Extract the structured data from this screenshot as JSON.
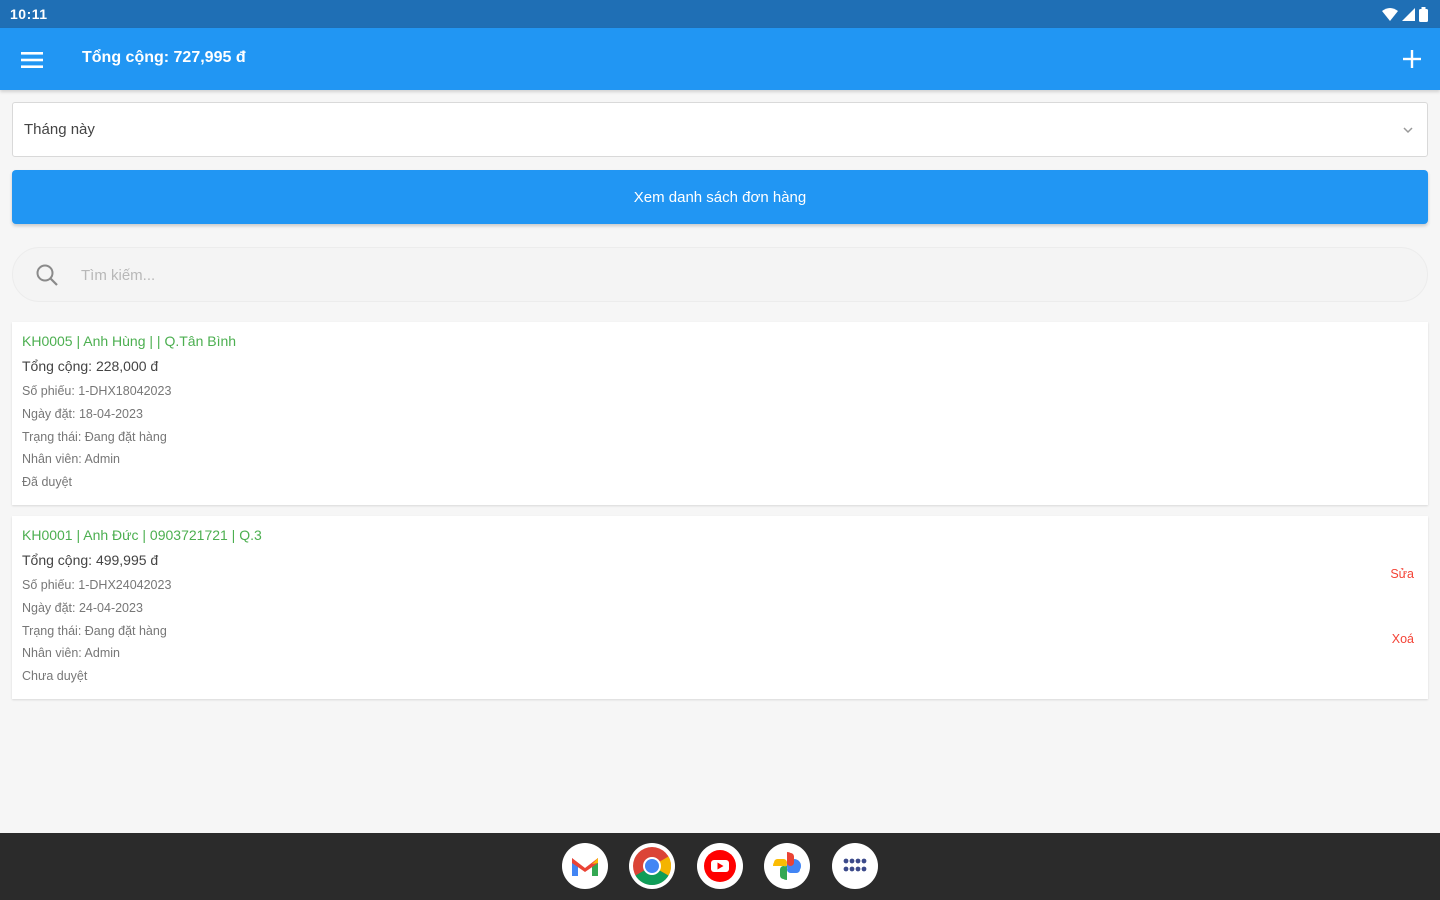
{
  "status_bar": {
    "time": "10:11",
    "icons": [
      "wifi-icon",
      "signal-icon",
      "battery-icon"
    ]
  },
  "app_bar": {
    "title": "Tổng cộng: 727,995 đ",
    "icons": [
      "menu-icon",
      "plus-icon"
    ]
  },
  "period_select": {
    "selected": "Tháng này"
  },
  "view_orders_button": {
    "label": "Xem danh sách đơn hàng"
  },
  "search": {
    "placeholder": "Tìm kiếm...",
    "value": ""
  },
  "orders": [
    {
      "header": "KH0005 | Anh Hùng |  | Q.Tân Bình",
      "total": "Tổng cộng: 228,000 đ",
      "ticket": "Số phiếu: 1-DHX18042023",
      "date": "Ngày đặt: 18-04-2023",
      "status": "Trạng thái: Đang đặt hàng",
      "employee": "Nhân viên: Admin",
      "approval": "Đã duyệt"
    },
    {
      "header": "KH0001 | Anh Đức | 0903721721 | Q.3",
      "total": "Tổng cộng: 499,995 đ",
      "ticket": "Số phiếu: 1-DHX24042023",
      "date": "Ngày đặt: 24-04-2023",
      "status": "Trạng thái: Đang đặt hàng",
      "employee": "Nhân viên: Admin",
      "approval": "Chưa duyệt",
      "edit_label": "Sửa",
      "delete_label": "Xoá"
    }
  ],
  "dock": {
    "apps": [
      "gmail-icon",
      "chrome-icon",
      "youtube-icon",
      "photos-icon",
      "app-drawer-icon"
    ]
  },
  "colors": {
    "primary": "#2196f3",
    "status_bar": "#1f6fb5",
    "customer_header": "#4caf50",
    "action_red": "#f44336",
    "nav_bar": "#2b2b2b"
  }
}
